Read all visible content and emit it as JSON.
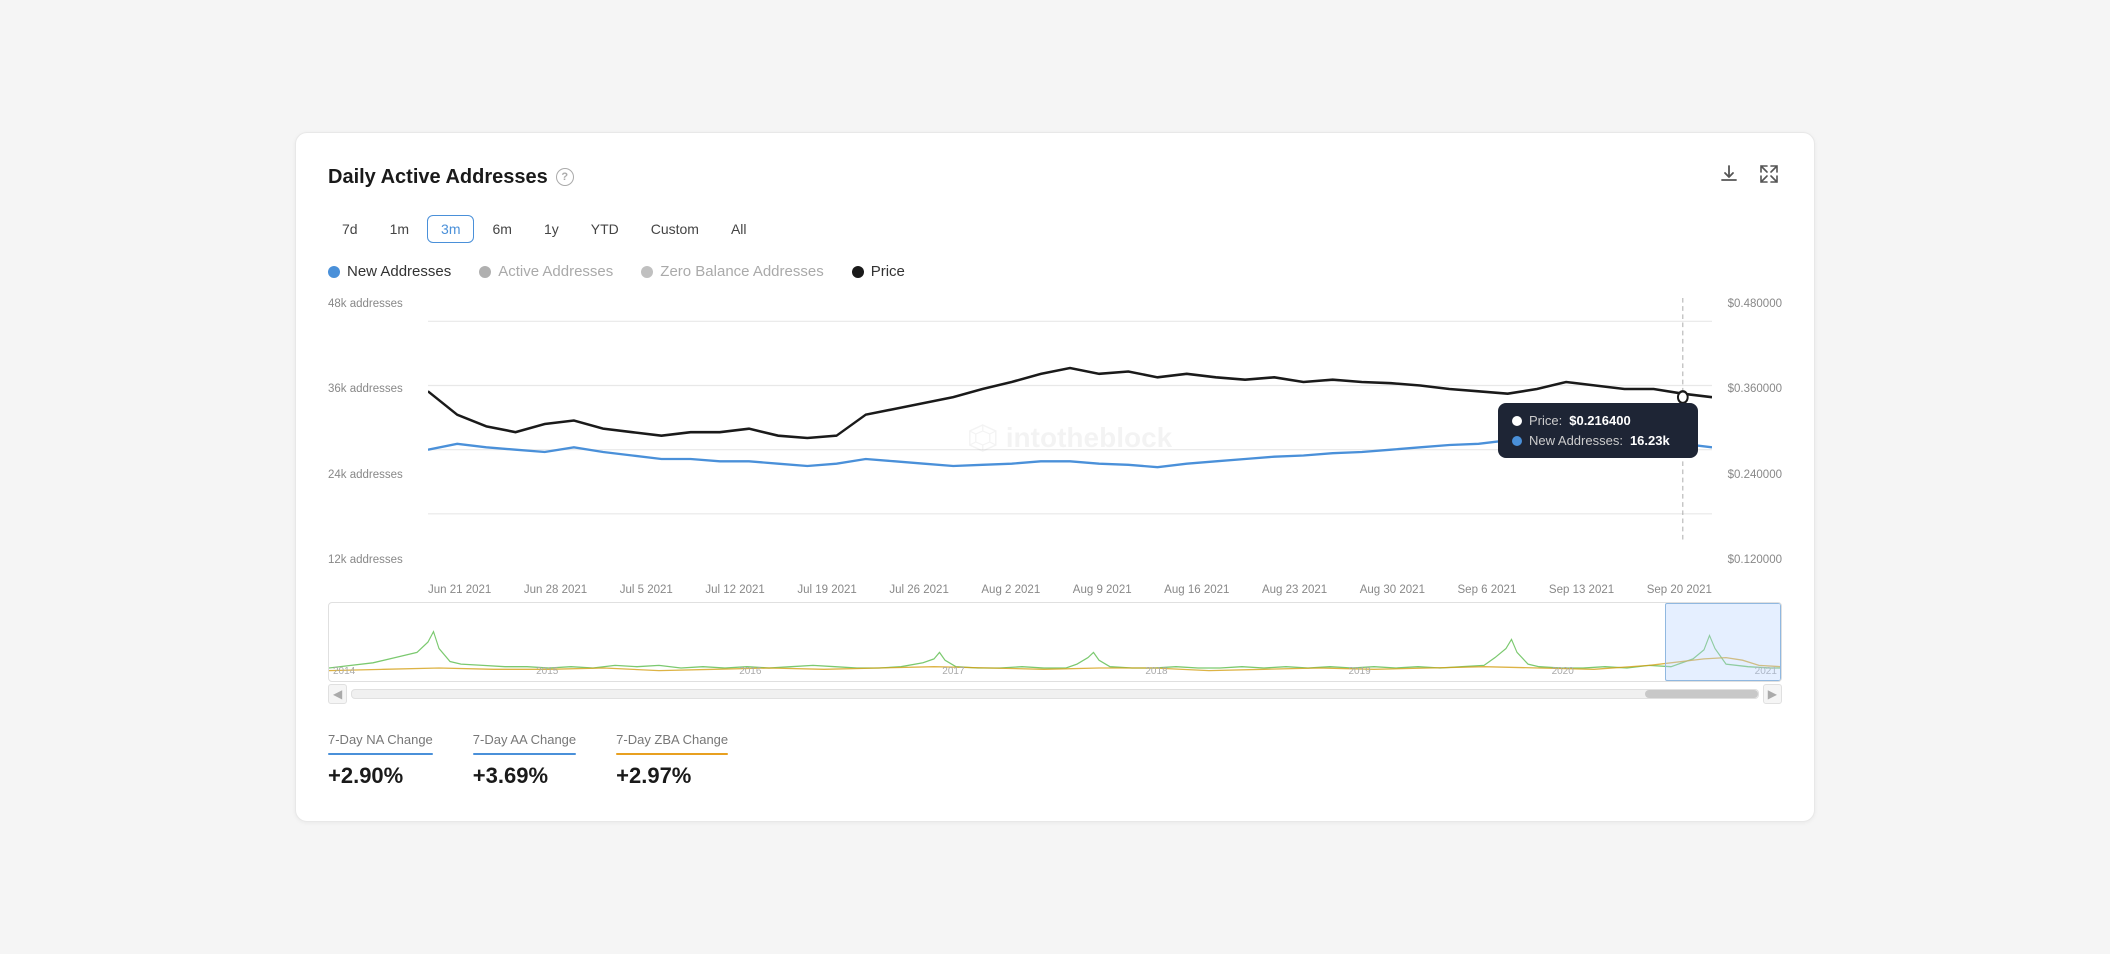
{
  "header": {
    "title": "Daily Active Addresses",
    "help_icon": "?",
    "download_label": "⬇",
    "expand_label": "⛶"
  },
  "time_filters": {
    "options": [
      "7d",
      "1m",
      "3m",
      "6m",
      "1y",
      "YTD",
      "Custom",
      "All"
    ],
    "active": "3m"
  },
  "legend": {
    "items": [
      {
        "label": "New Addresses",
        "color": "#4a90d9",
        "active": true
      },
      {
        "label": "Active Addresses",
        "color": "#b0b0b0",
        "active": false
      },
      {
        "label": "Zero Balance Addresses",
        "color": "#c0c0c0",
        "active": false
      },
      {
        "label": "Price",
        "color": "#1a1a1a",
        "active": true
      }
    ]
  },
  "y_axis_left": {
    "labels": [
      "48k addresses",
      "36k addresses",
      "24k addresses",
      "12k addresses"
    ]
  },
  "y_axis_right": {
    "labels": [
      "$0.480000",
      "$0.360000",
      "$0.240000",
      "$0.120000"
    ]
  },
  "x_axis": {
    "labels": [
      "Jun 21 2021",
      "Jun 28 2021",
      "Jul 5 2021",
      "Jul 12 2021",
      "Jul 19 2021",
      "Jul 26 2021",
      "Aug 2 2021",
      "Aug 9 2021",
      "Aug 16 2021",
      "Aug 23 2021",
      "Aug 30 2021",
      "Sep 6 2021",
      "Sep 13 2021",
      "Sep 20 2021"
    ]
  },
  "tooltip": {
    "price_label": "Price:",
    "price_value": "$0.216400",
    "new_addr_label": "New Addresses:",
    "new_addr_value": "16.23k"
  },
  "minimap": {
    "years": [
      "2014",
      "2015",
      "2016",
      "2017",
      "2018",
      "2019",
      "2020",
      "2021"
    ]
  },
  "stats": [
    {
      "label": "7-Day NA Change",
      "value": "+2.90%",
      "color": "#4a90d9"
    },
    {
      "label": "7-Day AA Change",
      "value": "+3.69%",
      "color": "#4a90d9"
    },
    {
      "label": "7-Day ZBA Change",
      "value": "+2.97%",
      "color": "#e8a020"
    }
  ],
  "watermark": "intotheblock"
}
